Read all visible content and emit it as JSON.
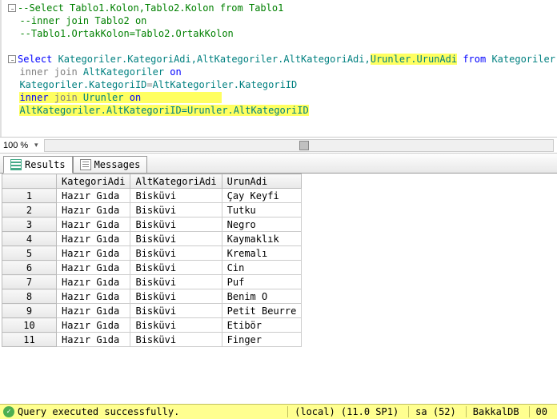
{
  "editor": {
    "l1": "--Select Tablo1.Kolon,Tablo2.Kolon from Tablo1",
    "l2": "--inner join Tablo2 on",
    "l3": "--Tablo1.OrtakKolon=Tablo2.OrtakKolon",
    "l5_select": "Select",
    "l5_cols": " Kategoriler.KategoriAdi,AltKategoriler.AltKategoriAdi,",
    "l5_hl": "Urunler.UrunAdi",
    "l5_from": " from",
    "l5_tbl": " Kategoriler",
    "l6_gray": "inner join",
    "l6_tbl": " AltKategoriler ",
    "l6_on": "on",
    "l7_left": "Kategoriler.KategoriID",
    "l7_eq": "=",
    "l7_right": "AltKategoriler.KategoriID",
    "l8_inner": "inner",
    "l8_join": " join",
    "l8_tbl": " Urunler ",
    "l8_on": "on",
    "l9": "AltKategoriler.AltKategoriID=Urunler.AltKategoriID"
  },
  "zoom": {
    "label": "100 %"
  },
  "tabs": {
    "results": "Results",
    "messages": "Messages"
  },
  "grid": {
    "headers": [
      "KategoriAdi",
      "AltKategoriAdi",
      "UrunAdi"
    ],
    "rows": [
      [
        "Hazır Gıda",
        "Bisküvi",
        "Çay Keyfi"
      ],
      [
        "Hazır Gıda",
        "Bisküvi",
        "Tutku"
      ],
      [
        "Hazır Gıda",
        "Bisküvi",
        "Negro"
      ],
      [
        "Hazır Gıda",
        "Bisküvi",
        "Kaymaklık"
      ],
      [
        "Hazır Gıda",
        "Bisküvi",
        "Kremalı"
      ],
      [
        "Hazır Gıda",
        "Bisküvi",
        "Cin"
      ],
      [
        "Hazır Gıda",
        "Bisküvi",
        "Puf"
      ],
      [
        "Hazır Gıda",
        "Bisküvi",
        "Benim O"
      ],
      [
        "Hazır Gıda",
        "Bisküvi",
        "Petit Beurre"
      ],
      [
        "Hazır Gıda",
        "Bisküvi",
        "Etibör"
      ],
      [
        "Hazır Gıda",
        "Bisküvi",
        "Finger"
      ]
    ]
  },
  "status": {
    "msg": "Query executed successfully.",
    "server": "(local) (11.0 SP1)",
    "user": "sa (52)",
    "db": "BakkalDB",
    "rows": "00"
  }
}
